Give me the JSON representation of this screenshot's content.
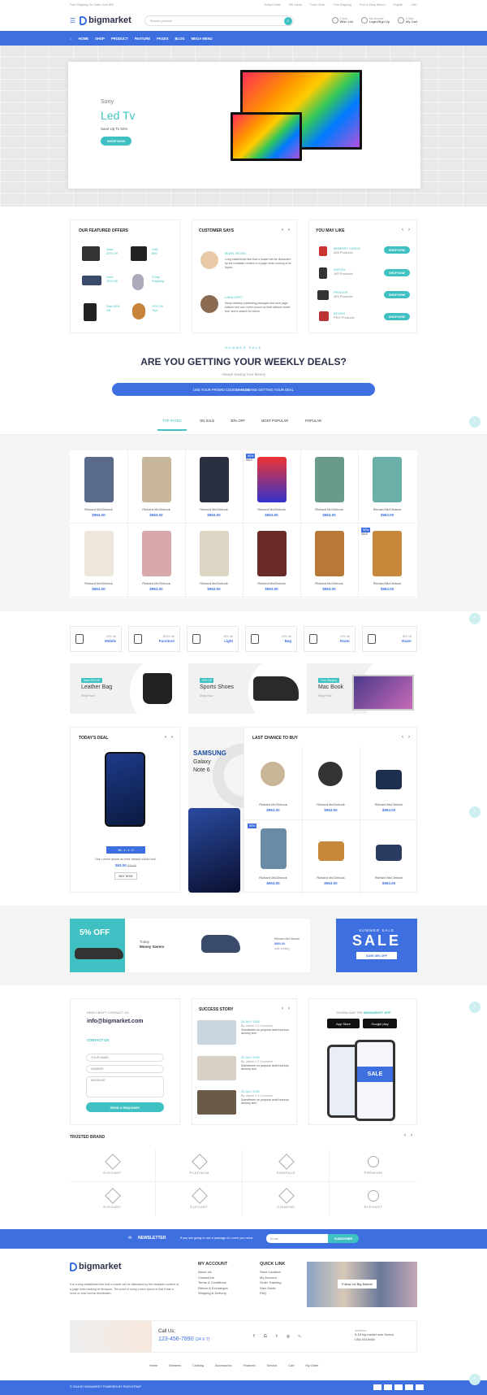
{
  "topbar": {
    "notice": "Free Shipping On Order Over $99",
    "links": [
      "Today's Deal",
      "Gift Cards",
      "Track Order",
      "Free Shipping",
      "Free & Easy Return"
    ],
    "language": "English",
    "currency": "USD"
  },
  "header": {
    "logo": "bigmarket",
    "search_placeholder": "Search product",
    "wishlist": {
      "top": "0 Item",
      "bottom": "Wish List"
    },
    "account": {
      "top": "My Account",
      "bottom": "Login/Sign Up"
    },
    "cart": {
      "top": "0 Item",
      "bottom": "My Cart"
    }
  },
  "nav": {
    "items": [
      "HOME",
      "SHOP",
      "PRODUCT",
      "FEATURE",
      "PAGES",
      "BLOG",
      "MEGA MENU"
    ]
  },
  "hero": {
    "brand": "Sony",
    "title": "Led Tv",
    "subtitle": "Save Up To 50%",
    "button": "SHOP NOW"
  },
  "featured": {
    "title": "OUR FEATURED OFFERS",
    "offers": [
      {
        "l1": "Save",
        "l2": "20% Off"
      },
      {
        "l1": "Only",
        "l2": "$99"
      },
      {
        "l1": "Save",
        "l2": "20% Off"
      },
      {
        "l1": "3 Day",
        "l2": "Shipping"
      },
      {
        "l1": "Sale 60%",
        "l2": "Off"
      },
      {
        "l1": "20% Off",
        "l2": "Toys"
      }
    ]
  },
  "customer": {
    "title": "CUSTOMER SAYS",
    "reviews": [
      {
        "name": "MARK JECNO",
        "text": "Long established fact that a reader will be distracted by the readable content of a page when looking at its layout."
      },
      {
        "name": "LARA OPPT",
        "text": "Many desktop publishing packages and web page editors now use Lorem Ipsum as their default model text, and a search for lorem."
      }
    ]
  },
  "maylike": {
    "title": "YOU MAY LIKE",
    "items": [
      {
        "name": "MEMORY CARDS",
        "count": "283 Products"
      },
      {
        "name": "WATCH",
        "count": "183 Products"
      },
      {
        "name": "PRINTER",
        "count": "453 Products"
      },
      {
        "name": "BOOKS",
        "count": "PRO Products"
      }
    ],
    "button": "SHOP NOW"
  },
  "deals": {
    "eyebrow": "SUMMER SALE",
    "title_a": "ARE YOU GETTING YOUR ",
    "title_b": "WEEKLY DEALS?",
    "sub": "Always Saving Your Money",
    "promo_a": "USE YOUR PROMO CODE ",
    "promo_code": "SAVE180",
    "promo_b": " AND GETTING YOUR DEAL"
  },
  "tabs": [
    "TOP RATED",
    "ON SALE",
    "30% OFF",
    "MOST POPULAR",
    "POPULAR"
  ],
  "product_grid": {
    "name": "Richard McClintock",
    "price": "$963.00",
    "new": "NEW",
    "sale": "SALE"
  },
  "categories": [
    {
      "pct": "20% off",
      "name": "Mobile"
    },
    {
      "pct": "$20% off",
      "name": "Furniture"
    },
    {
      "pct": "30% off",
      "name": "Light"
    },
    {
      "pct": "15% off",
      "name": "Bag"
    },
    {
      "pct": "10% off",
      "name": "Razer"
    },
    {
      "pct": "$20 off",
      "name": "Razer"
    }
  ],
  "promos": [
    {
      "tag": "Save 20% Off",
      "title": "Leather Bag",
      "link": "Shop Now"
    },
    {
      "tag": "50% Off",
      "title": "Sports Shoes",
      "link": "Shop Now"
    },
    {
      "tag": "Free Shipping",
      "title": "Mac Book",
      "link": "Shop Now"
    }
  ],
  "todays_deal": {
    "title": "TODAY'S DEAL",
    "countdown": "56 : 4 : 1 : 0",
    "desc": "Use Lorem Ipsum as their default model text.",
    "price": "$63.00",
    "old_price": "$75.00",
    "button": "BUY NOW"
  },
  "samsung": {
    "brand": "SAMSUNG",
    "line1": "Galaxy",
    "line2": "Note 6"
  },
  "last_chance": {
    "title": "LAST CHANCE TO BUY",
    "name": "Richard McClintock",
    "price": "$963.00",
    "new": "NEW"
  },
  "banner": {
    "discount": "5% OFF",
    "line1": "Today",
    "line2": "Money Savers",
    "name": "Richard McClintock",
    "price": "$963.00",
    "sold": "sale ending",
    "sale_top": "SUMMER SALE",
    "sale_big": "SALE",
    "sale_btn": "SAVE 30% OFF"
  },
  "contact": {
    "help": "NEED HELP? CONTACT US",
    "email": "info@bigmarket.com",
    "form_title": "CONTACT US",
    "name": "YOUR NAME",
    "number": "NUMBER",
    "message": "MESSAGE",
    "button": "SEND A ENQUIARY"
  },
  "success": {
    "title": "SUCCESS STORY",
    "posts": [
      {
        "date": "25 JULY 2018",
        "meta": "By: Admin // 0 Comment",
        "text": "Sometimes on purpose actel humour, dummy text."
      },
      {
        "date": "25 JULY 2018",
        "meta": "By: Admin // 0 Comment",
        "text": "Sometimes on purpose actel humour, dummy text."
      },
      {
        "date": "25 JULY 2018",
        "meta": "By: Admin // 0 Comment",
        "text": "Sometimes on purpose actel humour, dummy text."
      }
    ]
  },
  "app": {
    "title_a": "DOWNLOAD THE ",
    "title_b": "BIGMARKET APP",
    "appstore": "App Store",
    "playstore": "Google play",
    "screen": "SALE"
  },
  "brands": {
    "title": "TRUSTED BRAND",
    "items": [
      "ELEGANT",
      "PLATINUM",
      "EMERALD",
      "PREMIUM",
      "ELEGANT",
      "ELEGANT",
      "DIAMOND",
      "ELEGANT"
    ]
  },
  "newsletter": {
    "title": "NEWSLETTER",
    "text": "If you are going to use a passage of Lorem you need.",
    "placeholder": "Email...",
    "button": "SUBSCRIBE"
  },
  "footer": {
    "logo": "bigmarket",
    "about": "It is a long established fact that a reader will be distracted by the readable content of a page when looking at its layout. The point of using Lorem Ipsum is that it has a more-or-less normal distribution.",
    "account_title": "MY ACCOUNT",
    "account": [
      "About Us",
      "Contact Us",
      "Terms & Conditions",
      "Return & Exchanges",
      "Shipping & Delivery"
    ],
    "quick_title": "QUICK LINK",
    "quick": [
      "Store Location",
      "My Account",
      "Order Tracking",
      "Size Guide",
      "FAQ"
    ],
    "insta": "Follow Us Big Market",
    "call_label": "Call Us:",
    "phone": "123-456-7890",
    "phone_note": "(24 X 7)",
    "address_label": "Address:",
    "address1": "B-16 big market near School",
    "address2": "USA 453-8966",
    "bottom_links": [
      "Home",
      "Womens",
      "Clothing",
      "Accessories",
      "Featured",
      "Service",
      "Cart",
      "My Order"
    ],
    "copyright": "© 2018 BY BIGMARKET POWERED BY PIXELSTRAP"
  },
  "colors": {
    "primary": "#3d6fe0",
    "accent": "#3fc1c3"
  }
}
